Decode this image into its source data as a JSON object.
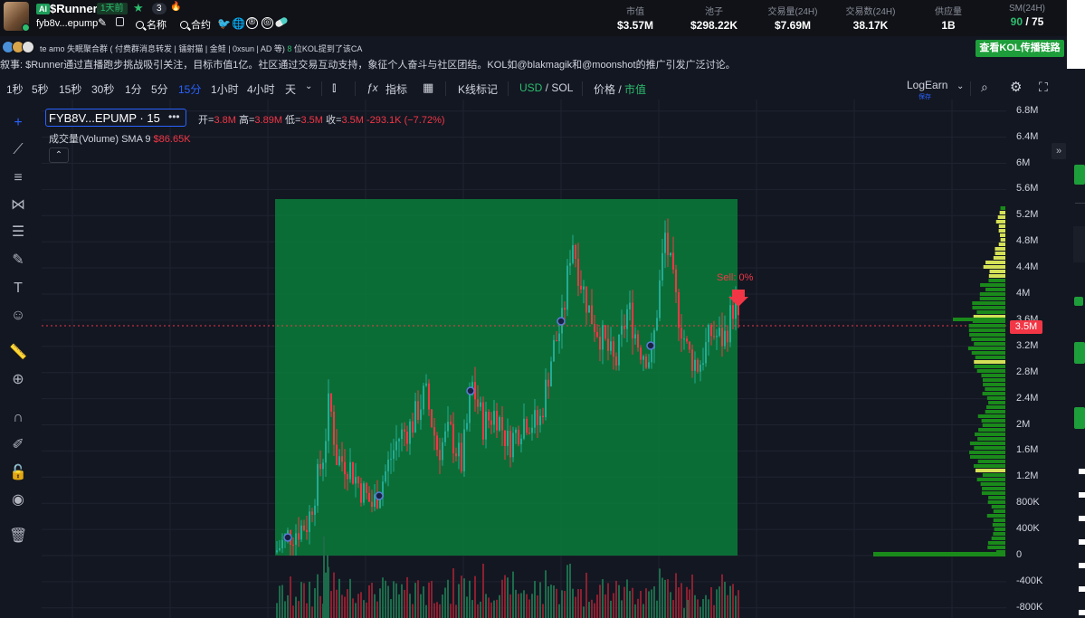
{
  "token": {
    "ai_badge": "AI",
    "name": "$Runner",
    "age": "1天前",
    "flame_count": "3",
    "address": "fyb8v...epump",
    "search_name_label": "名称",
    "search_contract_label": "合约"
  },
  "stats": [
    {
      "label": "市值",
      "value": "$3.57M"
    },
    {
      "label": "池子",
      "value": "$298.22K"
    },
    {
      "label": "交易量(24H)",
      "value": "$7.69M"
    },
    {
      "label": "交易数(24H)",
      "value": "38.17K"
    },
    {
      "label": "供应量",
      "value": "1B"
    }
  ],
  "sm": {
    "label": "SM(24H)",
    "green": "90",
    "rest": " / 75"
  },
  "kol": {
    "text": "te amo  失眠聚合群 ( 付费群消息转发 | 镭射猫 | 金鲑 | 0xsun | AD 等)",
    "count": "8",
    "count_text": " 位KOL提到了该CA",
    "button": "查看KOL传播链路"
  },
  "narrative": "叙事: $Runner通过直播跑步挑战吸引关注，目标市值1亿。社区通过交易互动支持，象征个人奋斗与社区团结。KOL如@blakmagik和@moonshot的推广引发广泛讨论。",
  "toolbar": {
    "intervals": [
      "1秒",
      "5秒",
      "15秒",
      "30秒",
      "1分",
      "5分",
      "15分",
      "1小时",
      "4小时",
      "天"
    ],
    "active_interval": "15分",
    "indicators": "指标",
    "kline_mark": "K线标记",
    "currency_usd": "USD",
    "currency_sep": " / ",
    "currency_sol": "SOL",
    "price_label": "价格",
    "price_sep": " / ",
    "mcap_label": "市值",
    "logearn": "LogEarn",
    "logearn_sub": "保存"
  },
  "legend": {
    "symbol": "FYB8V...EPUMP · 15",
    "open_label": "开=",
    "open": "3.8M",
    "high_label": "高=",
    "high": "3.89M",
    "low_label": "低=",
    "low": "3.5M",
    "close_label": "收=",
    "close": "3.5M",
    "change": "-293.1K (−7.72%)",
    "volume_label": "成交量(Volume) SMA 9",
    "volume_value": "$86.65K"
  },
  "sell_marker": "Sell: 0%",
  "current_price_tag": "3.5M",
  "chart_data": {
    "type": "candlestick",
    "y_axis_ticks": [
      "6.8M",
      "6.4M",
      "6M",
      "5.6M",
      "5.2M",
      "4.8M",
      "4.4M",
      "4M",
      "3.6M",
      "3.2M",
      "2.8M",
      "2.4M",
      "2M",
      "1.6M",
      "1.2M",
      "800K",
      "400K",
      "0",
      "-400K",
      "-800K"
    ],
    "ylim": [
      -800000,
      6800000
    ],
    "last_price": 3500000,
    "colors": {
      "up": "#22ab94",
      "down": "#f23645",
      "highlight": "#0b7d3a",
      "profile": "#1a8a1a",
      "profile_poc": "#d4e157"
    }
  }
}
